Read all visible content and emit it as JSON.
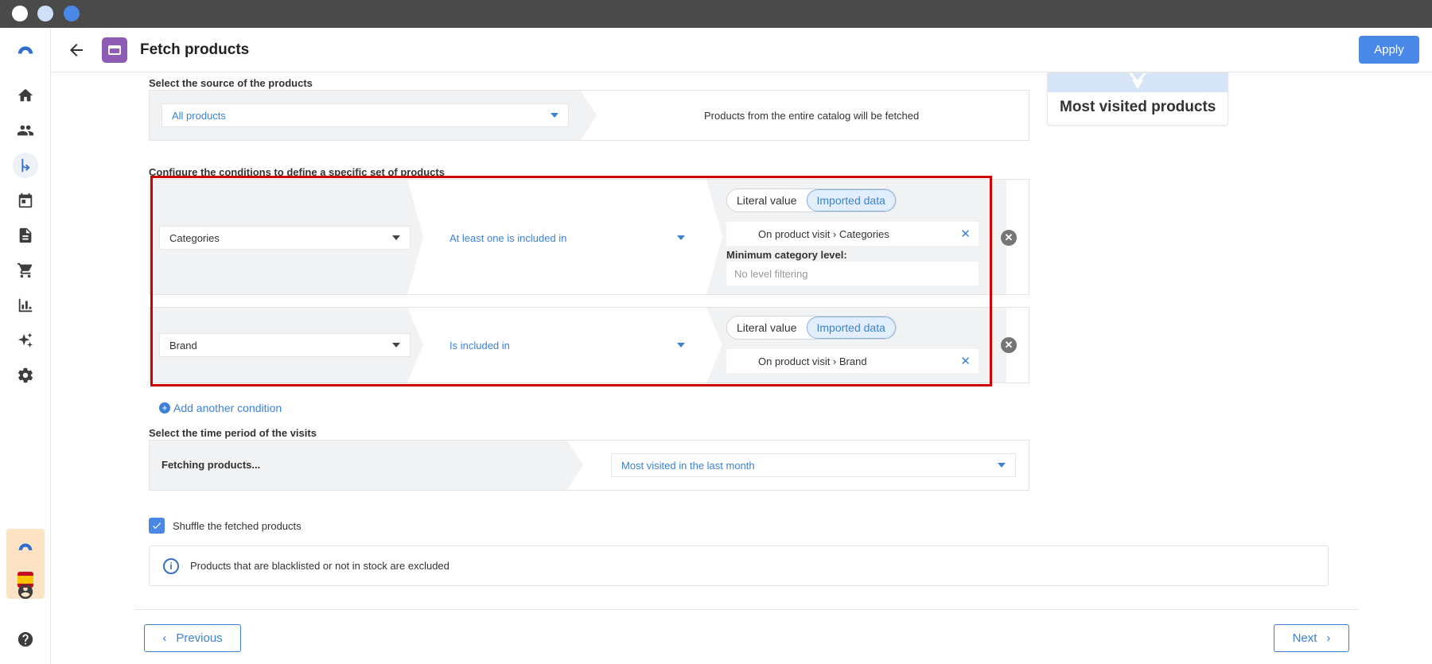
{
  "header": {
    "title": "Fetch products",
    "apply_label": "Apply"
  },
  "source": {
    "label": "Select the source of the products",
    "selected": "All products",
    "description": "Products from the entire catalog will be fetched"
  },
  "conditions": {
    "label": "Configure the conditions to define a specific set of products",
    "rows": [
      {
        "attribute": "Categories",
        "operator": "At least one is included in",
        "toggle": {
          "literal": "Literal value",
          "imported": "Imported data",
          "active": "imported"
        },
        "value": "On product visit › Categories",
        "extra_label": "Minimum category level:",
        "extra_value": "No level filtering"
      },
      {
        "attribute": "Brand",
        "operator": "Is included in",
        "toggle": {
          "literal": "Literal value",
          "imported": "Imported data",
          "active": "imported"
        },
        "value": "On product visit › Brand"
      }
    ],
    "add_label": "Add another condition"
  },
  "period": {
    "label": "Select the time period of the visits",
    "left": "Fetching products...",
    "selected": "Most visited in the last month"
  },
  "shuffle": {
    "label": "Shuffle the fetched products",
    "checked": true
  },
  "info": {
    "text": "Products that are blacklisted or not in stock are excluded"
  },
  "footer": {
    "previous_label": "Previous",
    "next_label": "Next"
  },
  "preview_card": {
    "title": "Most visited products"
  },
  "colors": {
    "accent": "#3b82d6",
    "apply": "#4a88e8",
    "highlight": "#d10000",
    "app_icon": "#8e5bb5"
  }
}
